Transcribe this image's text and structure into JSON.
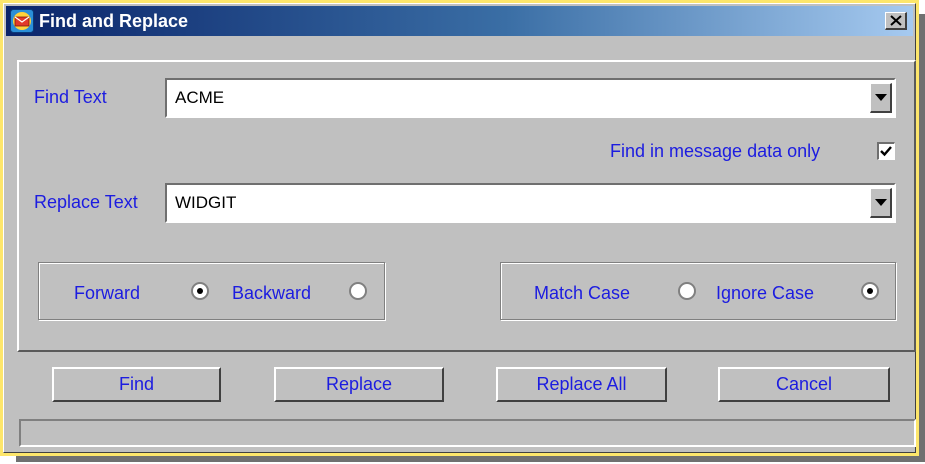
{
  "window": {
    "title": "Find and Replace",
    "close_glyph": "✕",
    "icon": "mail-envelope-icon"
  },
  "find": {
    "label": "Find Text",
    "value": "ACME"
  },
  "message_only": {
    "label": "Find in message data only",
    "checked": true
  },
  "replace": {
    "label": "Replace Text",
    "value": "WIDGIT"
  },
  "direction": {
    "forward_label": "Forward",
    "backward_label": "Backward",
    "selected": "Forward"
  },
  "case": {
    "match_label": "Match Case",
    "ignore_label": "Ignore Case",
    "selected": "Ignore Case"
  },
  "buttons": {
    "find": "Find",
    "replace": "Replace",
    "replace_all": "Replace All",
    "cancel": "Cancel"
  },
  "status": {
    "text": ""
  },
  "colors": {
    "label": "#1c1ce0",
    "face": "#c0c0c0",
    "frame": "#fde66b",
    "title_start": "#0a246a"
  }
}
